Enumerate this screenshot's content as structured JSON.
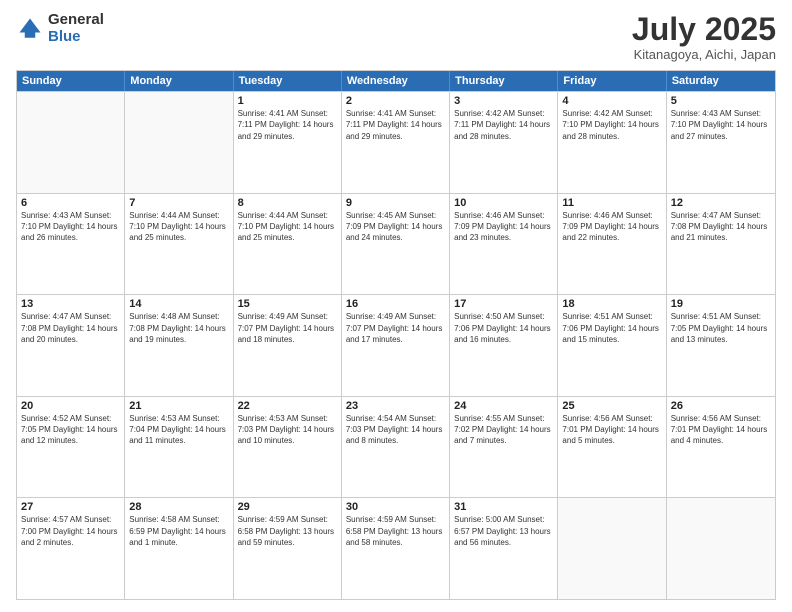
{
  "logo": {
    "general": "General",
    "blue": "Blue"
  },
  "header": {
    "month": "July 2025",
    "location": "Kitanagoya, Aichi, Japan"
  },
  "days_of_week": [
    "Sunday",
    "Monday",
    "Tuesday",
    "Wednesday",
    "Thursday",
    "Friday",
    "Saturday"
  ],
  "weeks": [
    [
      {
        "day": "",
        "info": ""
      },
      {
        "day": "",
        "info": ""
      },
      {
        "day": "1",
        "info": "Sunrise: 4:41 AM\nSunset: 7:11 PM\nDaylight: 14 hours and 29 minutes."
      },
      {
        "day": "2",
        "info": "Sunrise: 4:41 AM\nSunset: 7:11 PM\nDaylight: 14 hours and 29 minutes."
      },
      {
        "day": "3",
        "info": "Sunrise: 4:42 AM\nSunset: 7:11 PM\nDaylight: 14 hours and 28 minutes."
      },
      {
        "day": "4",
        "info": "Sunrise: 4:42 AM\nSunset: 7:10 PM\nDaylight: 14 hours and 28 minutes."
      },
      {
        "day": "5",
        "info": "Sunrise: 4:43 AM\nSunset: 7:10 PM\nDaylight: 14 hours and 27 minutes."
      }
    ],
    [
      {
        "day": "6",
        "info": "Sunrise: 4:43 AM\nSunset: 7:10 PM\nDaylight: 14 hours and 26 minutes."
      },
      {
        "day": "7",
        "info": "Sunrise: 4:44 AM\nSunset: 7:10 PM\nDaylight: 14 hours and 25 minutes."
      },
      {
        "day": "8",
        "info": "Sunrise: 4:44 AM\nSunset: 7:10 PM\nDaylight: 14 hours and 25 minutes."
      },
      {
        "day": "9",
        "info": "Sunrise: 4:45 AM\nSunset: 7:09 PM\nDaylight: 14 hours and 24 minutes."
      },
      {
        "day": "10",
        "info": "Sunrise: 4:46 AM\nSunset: 7:09 PM\nDaylight: 14 hours and 23 minutes."
      },
      {
        "day": "11",
        "info": "Sunrise: 4:46 AM\nSunset: 7:09 PM\nDaylight: 14 hours and 22 minutes."
      },
      {
        "day": "12",
        "info": "Sunrise: 4:47 AM\nSunset: 7:08 PM\nDaylight: 14 hours and 21 minutes."
      }
    ],
    [
      {
        "day": "13",
        "info": "Sunrise: 4:47 AM\nSunset: 7:08 PM\nDaylight: 14 hours and 20 minutes."
      },
      {
        "day": "14",
        "info": "Sunrise: 4:48 AM\nSunset: 7:08 PM\nDaylight: 14 hours and 19 minutes."
      },
      {
        "day": "15",
        "info": "Sunrise: 4:49 AM\nSunset: 7:07 PM\nDaylight: 14 hours and 18 minutes."
      },
      {
        "day": "16",
        "info": "Sunrise: 4:49 AM\nSunset: 7:07 PM\nDaylight: 14 hours and 17 minutes."
      },
      {
        "day": "17",
        "info": "Sunrise: 4:50 AM\nSunset: 7:06 PM\nDaylight: 14 hours and 16 minutes."
      },
      {
        "day": "18",
        "info": "Sunrise: 4:51 AM\nSunset: 7:06 PM\nDaylight: 14 hours and 15 minutes."
      },
      {
        "day": "19",
        "info": "Sunrise: 4:51 AM\nSunset: 7:05 PM\nDaylight: 14 hours and 13 minutes."
      }
    ],
    [
      {
        "day": "20",
        "info": "Sunrise: 4:52 AM\nSunset: 7:05 PM\nDaylight: 14 hours and 12 minutes."
      },
      {
        "day": "21",
        "info": "Sunrise: 4:53 AM\nSunset: 7:04 PM\nDaylight: 14 hours and 11 minutes."
      },
      {
        "day": "22",
        "info": "Sunrise: 4:53 AM\nSunset: 7:03 PM\nDaylight: 14 hours and 10 minutes."
      },
      {
        "day": "23",
        "info": "Sunrise: 4:54 AM\nSunset: 7:03 PM\nDaylight: 14 hours and 8 minutes."
      },
      {
        "day": "24",
        "info": "Sunrise: 4:55 AM\nSunset: 7:02 PM\nDaylight: 14 hours and 7 minutes."
      },
      {
        "day": "25",
        "info": "Sunrise: 4:56 AM\nSunset: 7:01 PM\nDaylight: 14 hours and 5 minutes."
      },
      {
        "day": "26",
        "info": "Sunrise: 4:56 AM\nSunset: 7:01 PM\nDaylight: 14 hours and 4 minutes."
      }
    ],
    [
      {
        "day": "27",
        "info": "Sunrise: 4:57 AM\nSunset: 7:00 PM\nDaylight: 14 hours and 2 minutes."
      },
      {
        "day": "28",
        "info": "Sunrise: 4:58 AM\nSunset: 6:59 PM\nDaylight: 14 hours and 1 minute."
      },
      {
        "day": "29",
        "info": "Sunrise: 4:59 AM\nSunset: 6:58 PM\nDaylight: 13 hours and 59 minutes."
      },
      {
        "day": "30",
        "info": "Sunrise: 4:59 AM\nSunset: 6:58 PM\nDaylight: 13 hours and 58 minutes."
      },
      {
        "day": "31",
        "info": "Sunrise: 5:00 AM\nSunset: 6:57 PM\nDaylight: 13 hours and 56 minutes."
      },
      {
        "day": "",
        "info": ""
      },
      {
        "day": "",
        "info": ""
      }
    ]
  ]
}
